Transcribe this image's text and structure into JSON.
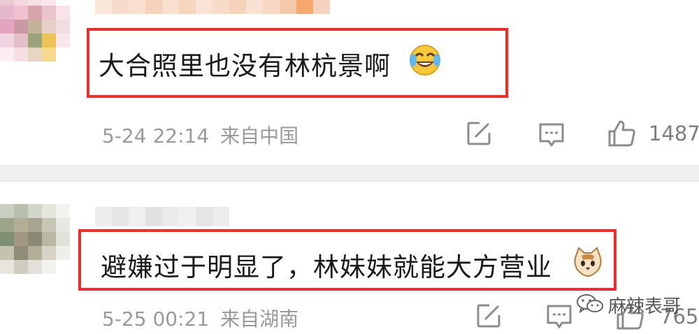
{
  "comments": [
    {
      "text": "大合照里也没有林杭景啊",
      "emoji": "laughing-crying-emoji",
      "date": "5-24 22:14",
      "location": "来自中国",
      "likes": "1487"
    },
    {
      "text": "避嫌过于明显了，林妹妹就能大方营业",
      "emoji": "cat-emoji",
      "date": "5-25 00:21",
      "location": "来自湖南",
      "likes": "765"
    }
  ],
  "watermark": {
    "text": "麻辣表哥",
    "icon": "wechat-icon"
  },
  "icons": [
    "share-icon",
    "comment-icon",
    "like-icon"
  ],
  "colors": {
    "highlight_border": "#ef2b2b",
    "meta_text": "#9a9a9a",
    "comment_text": "#1a1a1a",
    "divider": "#f0f0f0"
  }
}
